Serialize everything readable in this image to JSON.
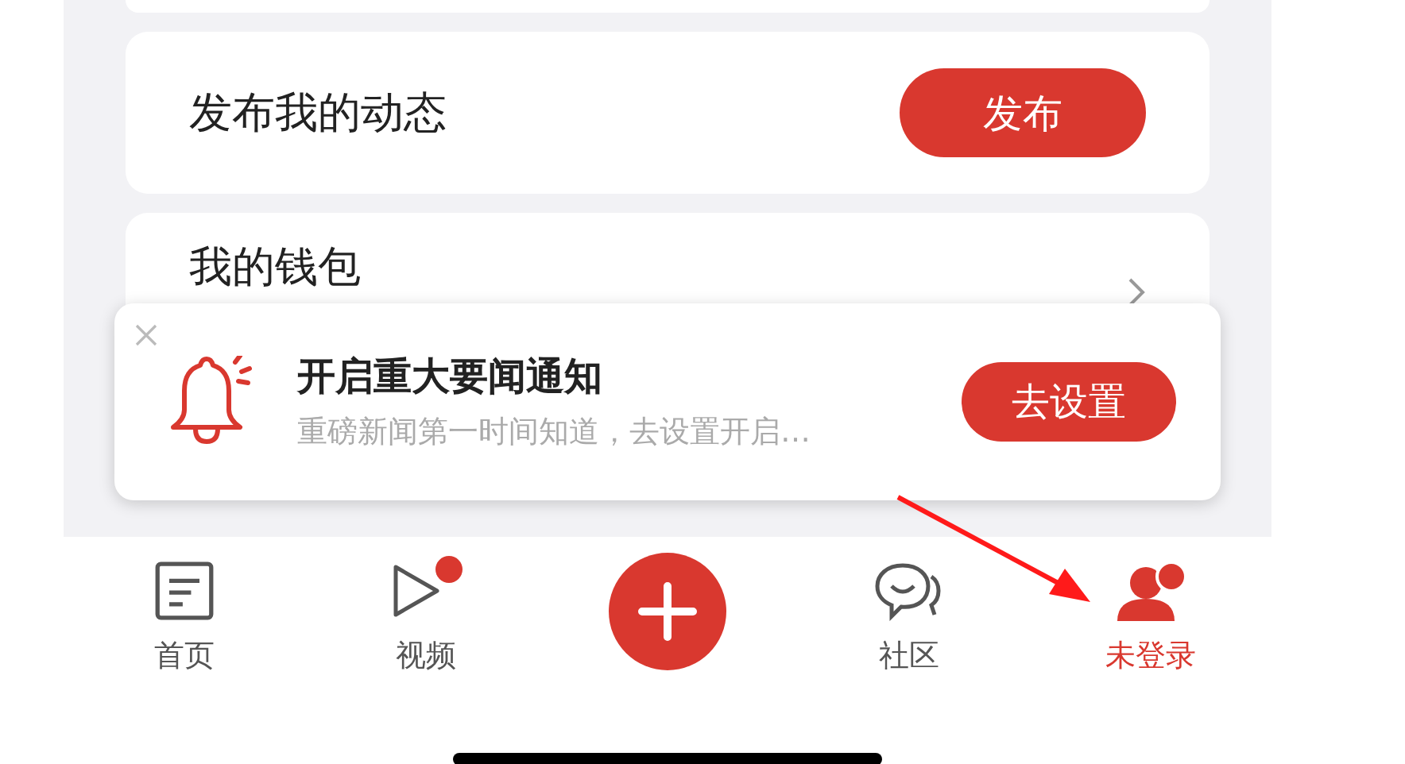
{
  "cards": [
    {
      "kind": "stub"
    },
    {
      "kind": "action",
      "label": "发布我的动态",
      "button": "发布"
    },
    {
      "kind": "link",
      "label": "我的钱包"
    }
  ],
  "notification": {
    "title": "开启重大要闻通知",
    "subtitle": "重磅新闻第一时间知道，去设置开启…",
    "button": "去设置"
  },
  "tab_bar": [
    {
      "kind": "home",
      "label": "首页",
      "selected": false,
      "badge": false
    },
    {
      "kind": "video",
      "label": "视频",
      "selected": false,
      "badge": true
    },
    {
      "kind": "plus"
    },
    {
      "kind": "community",
      "label": "社区",
      "selected": false,
      "badge": false
    },
    {
      "kind": "profile",
      "label": "未登录",
      "selected": true,
      "badge": false
    }
  ]
}
